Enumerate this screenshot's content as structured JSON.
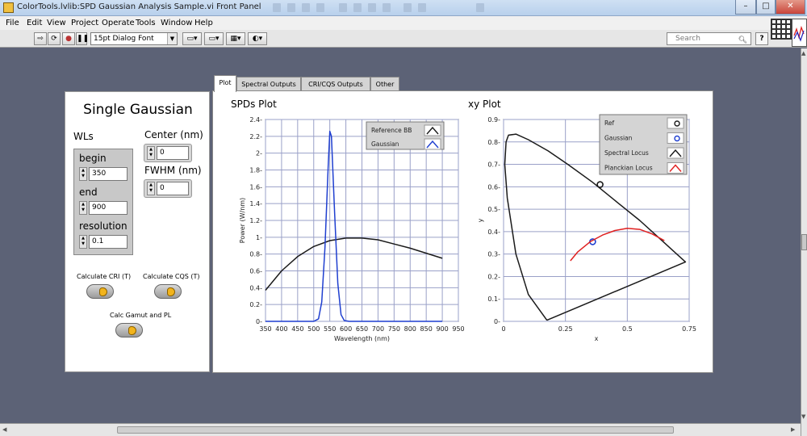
{
  "window": {
    "title": "ColorTools.lvlib:SPD Gaussian Analysis Sample.vi Front Panel",
    "minimize": "–",
    "maximize": "□",
    "close": "✕"
  },
  "menu": [
    "File",
    "Edit",
    "View",
    "Project",
    "Operate",
    "Tools",
    "Window",
    "Help"
  ],
  "toolbar": {
    "run_icon": "run-arrow-icon",
    "font": "15pt Dialog Font",
    "search_placeholder": "Search",
    "help": "?"
  },
  "left_panel": {
    "title": "Single Gaussian",
    "wls_label": "WLs",
    "begin_label": "begin",
    "begin_value": "350",
    "end_label": "end",
    "end_value": "900",
    "resolution_label": "resolution",
    "resolution_value": "0.1",
    "center_label": "Center (nm)",
    "center_value": "0",
    "fwhm_label": "FWHM (nm)",
    "fwhm_value": "0",
    "calc_cri_label": "Calculate CRI (T)",
    "calc_cqs_label": "Calculate CQS (T)",
    "calc_gamut_label": "Calc Gamut and PL"
  },
  "tabs": [
    "Plot",
    "Spectral Outputs",
    "CRI/CQS Outputs",
    "Other"
  ],
  "colors": {
    "black_series": "#1a1a1a",
    "blue_series": "#1f3fd0",
    "red_series": "#e02020",
    "led_on": "#f2b41c"
  },
  "chart_data": [
    {
      "type": "line",
      "title": "SPDs Plot",
      "xlabel": "Wavelength (nm)",
      "ylabel": "Power (W/nm)",
      "xlim": [
        350,
        950
      ],
      "ylim": [
        0,
        2.4
      ],
      "xticks": [
        "350",
        "400",
        "450",
        "500",
        "550",
        "600",
        "650",
        "700",
        "750",
        "800",
        "850",
        "900",
        "950"
      ],
      "yticks": [
        "0",
        "0.2",
        "0.4",
        "0.6",
        "0.8",
        "1",
        "1.2",
        "1.4",
        "1.6",
        "1.8",
        "2",
        "2.2",
        "2.4"
      ],
      "grid": true,
      "legend_position": "top-right",
      "series": [
        {
          "name": "Reference BB",
          "color": "#1a1a1a",
          "x": [
            350,
            400,
            450,
            500,
            550,
            600,
            650,
            700,
            750,
            800,
            850,
            900
          ],
          "y": [
            0.37,
            0.6,
            0.77,
            0.89,
            0.96,
            0.99,
            0.99,
            0.97,
            0.92,
            0.87,
            0.81,
            0.75
          ]
        },
        {
          "name": "Gaussian",
          "color": "#1f3fd0",
          "x": [
            350,
            500,
            515,
            525,
            535,
            545,
            550,
            555,
            565,
            575,
            585,
            595,
            610,
            900
          ],
          "y": [
            0,
            0,
            0.03,
            0.23,
            0.88,
            1.85,
            2.26,
            2.2,
            1.3,
            0.45,
            0.08,
            0.01,
            0,
            0
          ]
        }
      ]
    },
    {
      "type": "line",
      "title": "xy Plot",
      "xlabel": "x",
      "ylabel": "y",
      "xlim": [
        0,
        0.75
      ],
      "ylim": [
        0,
        0.9
      ],
      "xticks": [
        "0",
        "0.25",
        "0.5",
        "0.75"
      ],
      "yticks": [
        "0",
        "0.1",
        "0.2",
        "0.3",
        "0.4",
        "0.5",
        "0.6",
        "0.7",
        "0.8",
        "0.9"
      ],
      "grid": true,
      "legend_position": "top-right",
      "series": [
        {
          "name": "Ref",
          "color": "#1a1a1a",
          "marker": "circle",
          "x": [
            0.39
          ],
          "y": [
            0.61
          ]
        },
        {
          "name": "Gaussian",
          "color": "#1f3fd0",
          "marker": "circle",
          "x": [
            0.36
          ],
          "y": [
            0.355
          ]
        },
        {
          "name": "Spectral Locus",
          "color": "#1a1a1a",
          "x": [
            0.175,
            0.1,
            0.05,
            0.015,
            0.005,
            0.01,
            0.02,
            0.05,
            0.1,
            0.18,
            0.26,
            0.36,
            0.46,
            0.55,
            0.63,
            0.69,
            0.735,
            0.175
          ],
          "y": [
            0.005,
            0.12,
            0.3,
            0.55,
            0.7,
            0.8,
            0.83,
            0.835,
            0.81,
            0.76,
            0.7,
            0.62,
            0.53,
            0.45,
            0.37,
            0.31,
            0.265,
            0.005
          ]
        },
        {
          "name": "Planckian Locus",
          "color": "#e02020",
          "x": [
            0.27,
            0.3,
            0.35,
            0.4,
            0.45,
            0.5,
            0.55,
            0.6,
            0.65
          ],
          "y": [
            0.27,
            0.31,
            0.355,
            0.385,
            0.405,
            0.415,
            0.41,
            0.39,
            0.36
          ]
        }
      ]
    }
  ]
}
